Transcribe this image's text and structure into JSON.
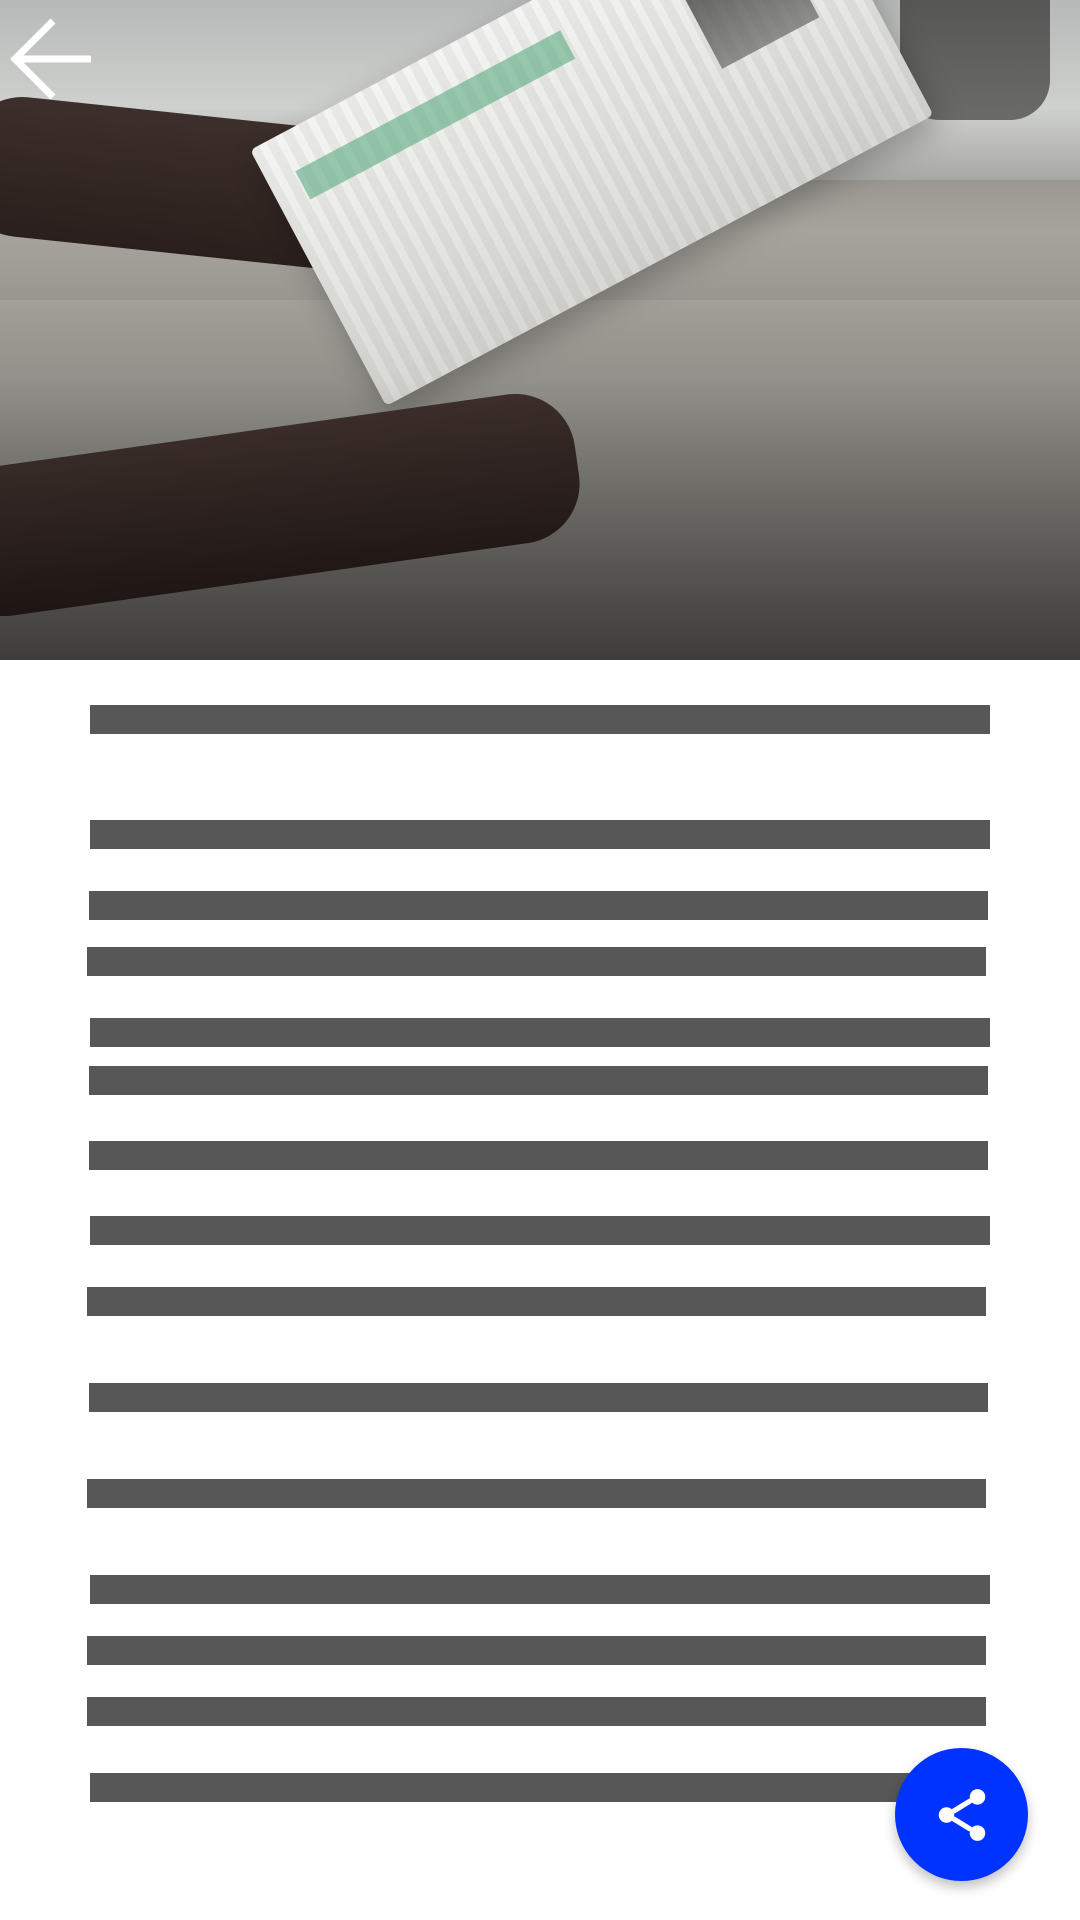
{
  "screen": {
    "name": "article-detail"
  },
  "hero": {
    "image": "newspaper-reading-photo"
  },
  "header": {
    "back_icon": "arrow-left-icon"
  },
  "content": {
    "placeholder_lines": 15
  },
  "fab": {
    "icon": "share-icon",
    "color": "#0033FF"
  },
  "colors": {
    "text_placeholder": "#575757",
    "background": "#FFFFFF",
    "back_icon": "#FFFFFF"
  }
}
